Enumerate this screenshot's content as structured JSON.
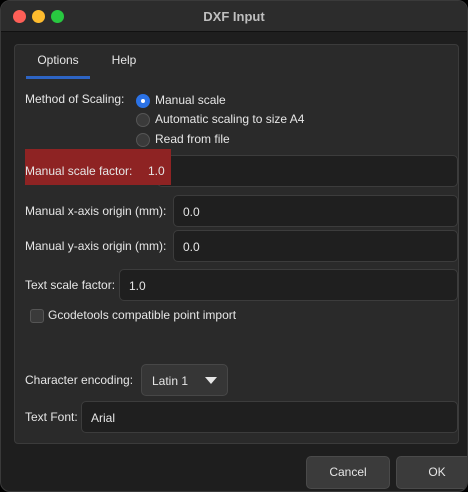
{
  "window": {
    "title": "DXF Input"
  },
  "tabs": [
    {
      "label": "Options"
    },
    {
      "label": "Help"
    }
  ],
  "scaling": {
    "label": "Method of Scaling:",
    "options": [
      {
        "label": "Manual scale",
        "checked": true
      },
      {
        "label": "Automatic scaling to size A4",
        "checked": false
      },
      {
        "label": "Read from file",
        "checked": false
      }
    ]
  },
  "fields": {
    "manual_scale_factor": {
      "label": "Manual scale factor:",
      "value": "1.0"
    },
    "x_origin": {
      "label": "Manual x-axis origin (mm):",
      "value": "0.0"
    },
    "y_origin": {
      "label": "Manual y-axis origin (mm):",
      "value": "0.0"
    },
    "text_scale": {
      "label": "Text scale factor:",
      "value": "1.0"
    }
  },
  "gcodetools": {
    "label": "Gcodetools compatible point import",
    "checked": false
  },
  "encoding": {
    "label": "Character encoding:",
    "value": "Latin 1"
  },
  "font": {
    "label": "Text Font:",
    "value": "Arial"
  },
  "buttons": {
    "cancel": "Cancel",
    "ok": "OK"
  },
  "colors": {
    "accent": "#2b72e6",
    "highlight": "#8e2323",
    "tab_underline": "#2d64c4"
  }
}
